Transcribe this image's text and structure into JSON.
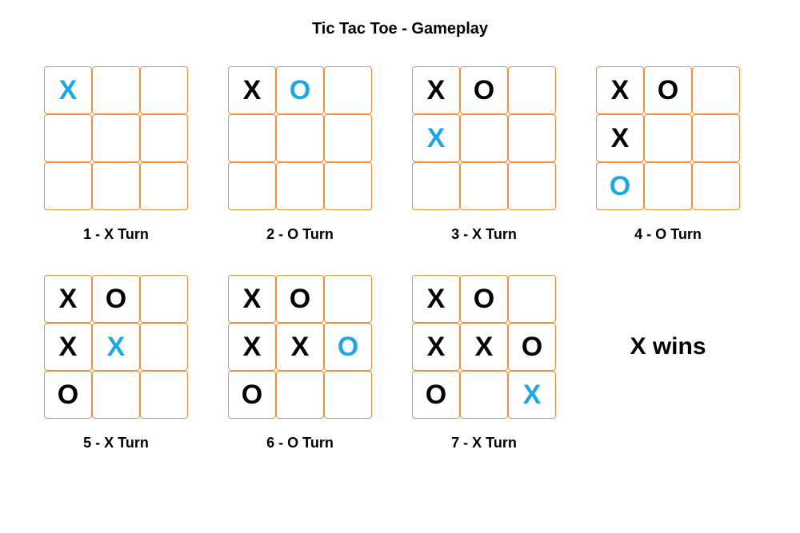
{
  "title": "Tic Tac Toe - Gameplay",
  "result": "X wins",
  "boards": [
    {
      "caption": "1 - X Turn",
      "cells": [
        {
          "v": "X",
          "c": "blue"
        },
        {
          "v": "",
          "c": ""
        },
        {
          "v": "",
          "c": ""
        },
        {
          "v": "",
          "c": ""
        },
        {
          "v": "",
          "c": ""
        },
        {
          "v": "",
          "c": ""
        },
        {
          "v": "",
          "c": ""
        },
        {
          "v": "",
          "c": ""
        },
        {
          "v": "",
          "c": ""
        }
      ]
    },
    {
      "caption": "2 - O Turn",
      "cells": [
        {
          "v": "X",
          "c": "black"
        },
        {
          "v": "O",
          "c": "blue"
        },
        {
          "v": "",
          "c": ""
        },
        {
          "v": "",
          "c": ""
        },
        {
          "v": "",
          "c": ""
        },
        {
          "v": "",
          "c": ""
        },
        {
          "v": "",
          "c": ""
        },
        {
          "v": "",
          "c": ""
        },
        {
          "v": "",
          "c": ""
        }
      ]
    },
    {
      "caption": "3 - X Turn",
      "cells": [
        {
          "v": "X",
          "c": "black"
        },
        {
          "v": "O",
          "c": "black"
        },
        {
          "v": "",
          "c": ""
        },
        {
          "v": "X",
          "c": "blue"
        },
        {
          "v": "",
          "c": ""
        },
        {
          "v": "",
          "c": ""
        },
        {
          "v": "",
          "c": ""
        },
        {
          "v": "",
          "c": ""
        },
        {
          "v": "",
          "c": ""
        }
      ]
    },
    {
      "caption": "4 - O Turn",
      "cells": [
        {
          "v": "X",
          "c": "black"
        },
        {
          "v": "O",
          "c": "black"
        },
        {
          "v": "",
          "c": ""
        },
        {
          "v": "X",
          "c": "black"
        },
        {
          "v": "",
          "c": ""
        },
        {
          "v": "",
          "c": ""
        },
        {
          "v": "O",
          "c": "blue"
        },
        {
          "v": "",
          "c": ""
        },
        {
          "v": "",
          "c": ""
        }
      ]
    },
    {
      "caption": "5 - X Turn",
      "cells": [
        {
          "v": "X",
          "c": "black"
        },
        {
          "v": "O",
          "c": "black"
        },
        {
          "v": "",
          "c": ""
        },
        {
          "v": "X",
          "c": "black"
        },
        {
          "v": "X",
          "c": "blue"
        },
        {
          "v": "",
          "c": ""
        },
        {
          "v": "O",
          "c": "black"
        },
        {
          "v": "",
          "c": ""
        },
        {
          "v": "",
          "c": ""
        }
      ]
    },
    {
      "caption": "6 - O Turn",
      "cells": [
        {
          "v": "X",
          "c": "black"
        },
        {
          "v": "O",
          "c": "black"
        },
        {
          "v": "",
          "c": ""
        },
        {
          "v": "X",
          "c": "black"
        },
        {
          "v": "X",
          "c": "black"
        },
        {
          "v": "O",
          "c": "blue"
        },
        {
          "v": "O",
          "c": "black"
        },
        {
          "v": "",
          "c": ""
        },
        {
          "v": "",
          "c": ""
        }
      ]
    },
    {
      "caption": "7 - X Turn",
      "cells": [
        {
          "v": "X",
          "c": "black"
        },
        {
          "v": "O",
          "c": "black"
        },
        {
          "v": "",
          "c": ""
        },
        {
          "v": "X",
          "c": "black"
        },
        {
          "v": "X",
          "c": "black"
        },
        {
          "v": "O",
          "c": "black"
        },
        {
          "v": "O",
          "c": "black"
        },
        {
          "v": "",
          "c": ""
        },
        {
          "v": "X",
          "c": "blue"
        }
      ]
    }
  ]
}
